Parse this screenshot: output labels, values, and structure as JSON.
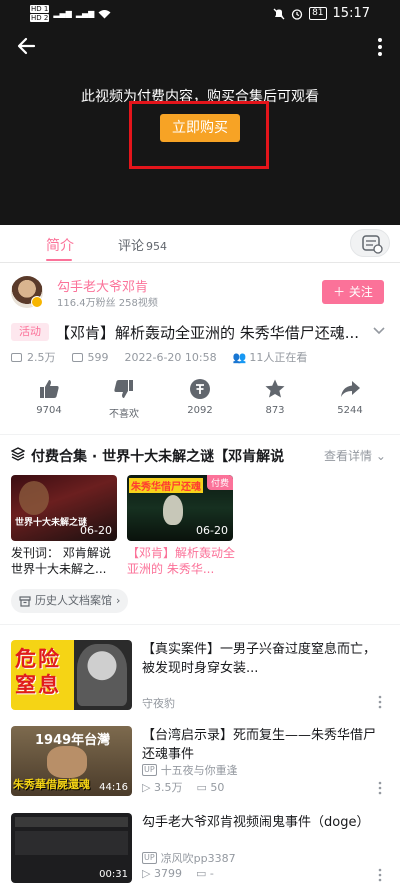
{
  "status_bar": {
    "hd1": "HD 1",
    "hd2": "HD 2",
    "signal1": "5G",
    "signal2": "4G",
    "battery": "81",
    "time": "15:17"
  },
  "player": {
    "paid_message": "此视频为付费内容，购买合集后可观看",
    "buy_label": "立即购买"
  },
  "tabs": {
    "intro": "简介",
    "comments": "评论",
    "comments_count": "954"
  },
  "uploader": {
    "name": "勾手老大爷邓肯",
    "stats": "116.4万粉丝    258视频",
    "follow_label": "＋ 关注"
  },
  "video": {
    "tag": "活动",
    "title": "【邓肯】解析轰动全亚洲的 朱秀华借尸还魂...",
    "views": "2.5万",
    "danmaku": "599",
    "date": "2022-6-20 10:58",
    "watching": "11人正在看"
  },
  "actions": [
    {
      "icon": "thumb-up-icon",
      "label": "9704"
    },
    {
      "icon": "thumb-down-icon",
      "label": "不喜欢"
    },
    {
      "icon": "coin-icon",
      "label": "2092"
    },
    {
      "icon": "star-icon",
      "label": "873"
    },
    {
      "icon": "share-icon",
      "label": "5244"
    }
  ],
  "collection": {
    "title": "付费合集 · 世界十大未解之谜【邓肯解说",
    "more": "查看详情",
    "items": [
      {
        "duration": "06-20",
        "caption": "发刊词：  邓肯解说世界十大未解之...",
        "thumb_text": "世界十大未解之谜"
      },
      {
        "duration": "06-20",
        "caption": "【邓肯】解析轰动全亚洲的 朱秀华...",
        "thumb_text": "朱秀华借尸还魂",
        "badge": "付费"
      }
    ],
    "channel": "历史人文档案馆"
  },
  "related": [
    {
      "title": "【真实案件】一男子兴奋过度窒息而亡，被发现时身穿女装...",
      "up": "守夜豹",
      "thumb_text": "危险窒息",
      "views": "",
      "danmaku": ""
    },
    {
      "title": "【台湾启示录】死而复生——朱秀华借尸还魂事件",
      "up": "十五夜与你重逢",
      "thumb_text": "1949年台灣",
      "thumb_sub": "朱秀華借屍還魂",
      "views": "3.5万",
      "danmaku": "50",
      "duration": "44:16"
    },
    {
      "title": "勾手老大爷邓肯视频闹鬼事件（doge）",
      "up": "凉风吹pp3387",
      "views": "3799",
      "danmaku": "-",
      "duration": "00:31"
    }
  ]
}
